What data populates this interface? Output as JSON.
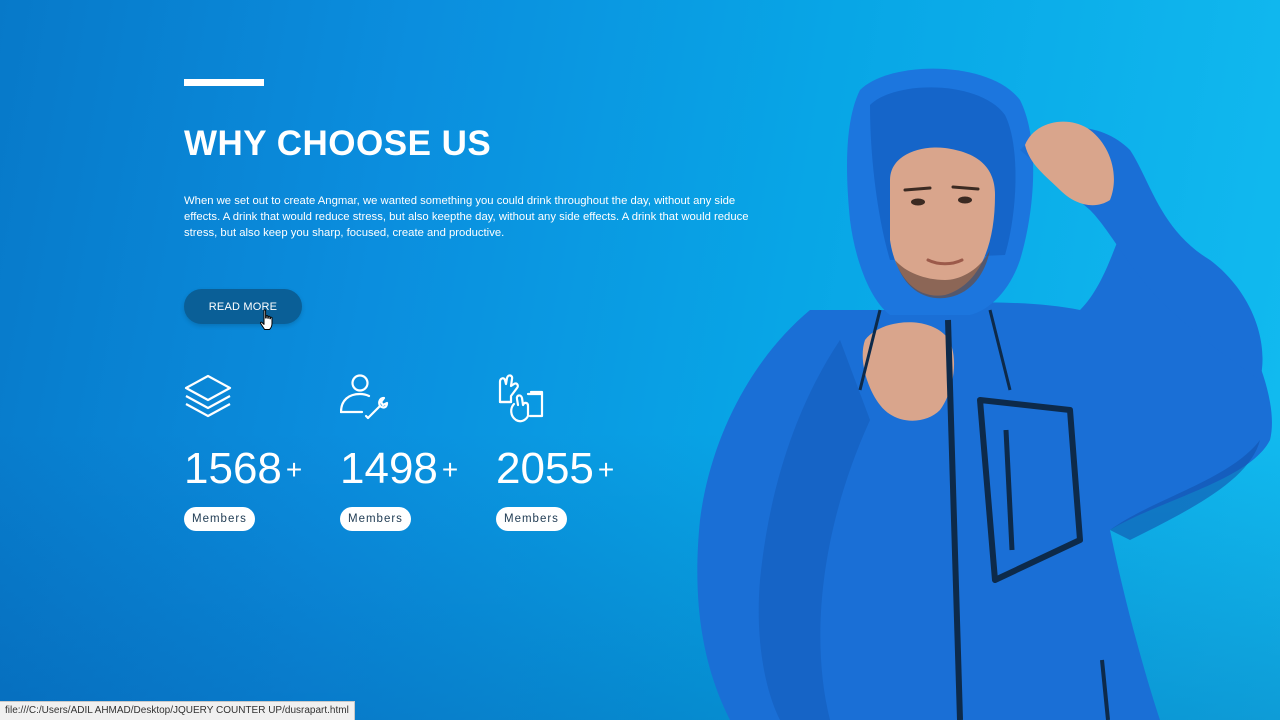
{
  "section": {
    "title": "WHY CHOOSE US",
    "description": "When we set out to create Angmar, we wanted something you could drink throughout the day, without any side effects. A drink that would reduce stress, but also keepthe day, without any side effects. A drink that would reduce stress, but also keep you sharp, focused, create and productive.",
    "read_more_label": "READ MORE"
  },
  "stats": [
    {
      "icon": "layers-icon",
      "value": "1568",
      "suffix": "+",
      "label": "Members"
    },
    {
      "icon": "user-wrench-icon",
      "value": "1498",
      "suffix": "+",
      "label": "Members"
    },
    {
      "icon": "gloves-icon",
      "value": "2055",
      "suffix": "+",
      "label": "Members"
    }
  ],
  "hero_image": {
    "subject": "person-in-blue-hooded-jacket"
  },
  "status_bar": {
    "url": "file:///C:/Users/ADIL AHMAD/Desktop/JQUERY COUNTER UP/dusrapart.html"
  },
  "colors": {
    "background_left": "#0779c9",
    "background_right": "#12bcf0",
    "button": "#0a5f97",
    "text": "#ffffff",
    "badge_text": "#1e3a52",
    "jacket": "#1a6fd6"
  }
}
